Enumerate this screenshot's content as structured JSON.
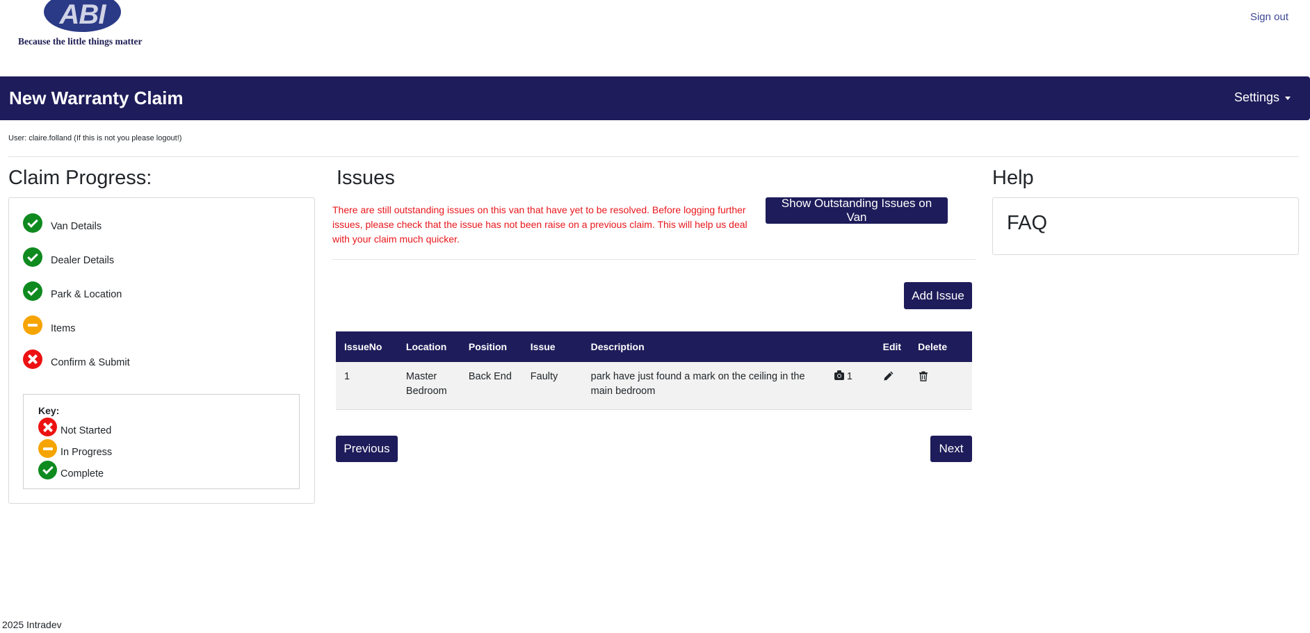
{
  "brand": {
    "logo_text": "ABI",
    "tagline": "Because the little things matter"
  },
  "header": {
    "sign_out": "Sign out"
  },
  "navbar": {
    "title": "New Warranty Claim",
    "settings": "Settings"
  },
  "user_line": "User: claire.folland (If this is not you please logout!)",
  "claim_progress": {
    "heading": "Claim Progress:",
    "steps": [
      {
        "label": "Van Details",
        "status": "complete"
      },
      {
        "label": "Dealer Details",
        "status": "complete"
      },
      {
        "label": "Park & Location",
        "status": "complete"
      },
      {
        "label": "Items",
        "status": "in-progress"
      },
      {
        "label": "Confirm & Submit",
        "status": "not-started"
      }
    ],
    "key": {
      "title": "Key:",
      "items": [
        {
          "label": "Not Started",
          "status": "not-started"
        },
        {
          "label": "In Progress",
          "status": "in-progress"
        },
        {
          "label": "Complete",
          "status": "complete"
        }
      ]
    }
  },
  "issues": {
    "heading": "Issues",
    "warning": "There are still outstanding issues on this van that have yet to be resolved. Before logging further issues, please check that the issue has not been raise on a previous claim. This will help us deal with your claim much quicker.",
    "show_outstanding_button": "Show Outstanding Issues on Van",
    "add_issue_button": "Add Issue",
    "table": {
      "headers": [
        "IssueNo",
        "Location",
        "Position",
        "Issue",
        "Description",
        "",
        "Edit",
        "Delete"
      ],
      "rows": [
        {
          "issue_no": "1",
          "location": "Master Bedroom",
          "position": "Back End",
          "issue": "Faulty",
          "description": "park have just found a mark on the ceiling in the main bedroom",
          "photo_count": "1"
        }
      ]
    },
    "previous_button": "Previous",
    "next_button": "Next"
  },
  "help": {
    "heading": "Help",
    "faq": "FAQ"
  },
  "footer": "2025 Intradev",
  "colors": {
    "navy": "#1e1c5a",
    "complete": "#0f8a1f",
    "in_progress": "#f6a400",
    "not_started": "#ec1212",
    "warning": "#e8161b",
    "link": "#3d4794"
  },
  "icons": {
    "complete": "check-circle-icon",
    "in_progress": "minus-circle-icon",
    "not_started": "x-circle-icon",
    "photo": "camera-icon",
    "edit": "pencil-icon",
    "delete": "trash-icon"
  }
}
